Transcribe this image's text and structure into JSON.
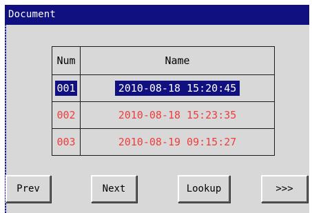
{
  "window": {
    "title": "Document"
  },
  "table": {
    "headers": {
      "num": "Num",
      "name": "Name"
    },
    "rows": [
      {
        "num": "001",
        "name": "2010-08-18 15:20:45",
        "selected": true
      },
      {
        "num": "002",
        "name": "2010-08-18 15:23:35",
        "selected": false
      },
      {
        "num": "003",
        "name": "2010-08-19 09:15:27",
        "selected": false
      }
    ]
  },
  "buttons": {
    "prev": "Prev",
    "next": "Next",
    "lookup": "Lookup",
    "more": ">>>"
  },
  "colors": {
    "titlebar": "#101080",
    "selection": "#101080",
    "row_text": "#f03c3c",
    "background": "#d8d8d8"
  }
}
